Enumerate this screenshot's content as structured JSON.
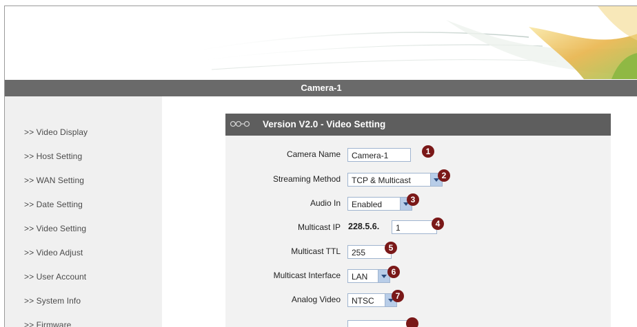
{
  "header": {
    "title": "Camera-1"
  },
  "sidebar": {
    "items": [
      {
        "label": ">> Video Display"
      },
      {
        "label": ">> Host Setting"
      },
      {
        "label": ">> WAN Setting"
      },
      {
        "label": ">> Date Setting"
      },
      {
        "label": ">> Video Setting"
      },
      {
        "label": ">> Video Adjust"
      },
      {
        "label": ">> User Account"
      },
      {
        "label": ">> System Info"
      },
      {
        "label": ">> Firmware"
      }
    ]
  },
  "panel": {
    "title": "Version V2.0 - Video Setting",
    "fields": {
      "camera_name": {
        "label": "Camera Name",
        "value": "Camera-1",
        "badge": "1"
      },
      "streaming_method": {
        "label": "Streaming Method",
        "value": "TCP & Multicast",
        "badge": "2"
      },
      "audio_in": {
        "label": "Audio In",
        "value": "Enabled",
        "badge": "3"
      },
      "multicast_ip": {
        "label": "Multicast IP",
        "prefix": "228.5.6.",
        "value": "1",
        "badge": "4"
      },
      "multicast_ttl": {
        "label": "Multicast TTL",
        "value": "255",
        "badge": "5"
      },
      "multicast_interface": {
        "label": "Multicast Interface",
        "value": "LAN",
        "badge": "6"
      },
      "analog_video": {
        "label": "Analog Video",
        "value": "NTSC",
        "badge": "7"
      }
    }
  },
  "colors": {
    "title_bar": "#6a6a6a",
    "panel_header": "#5e5e5e",
    "badge": "#7a1818",
    "sidebar_bg": "#f0f0f0",
    "panel_bg": "#f2f2f2"
  }
}
